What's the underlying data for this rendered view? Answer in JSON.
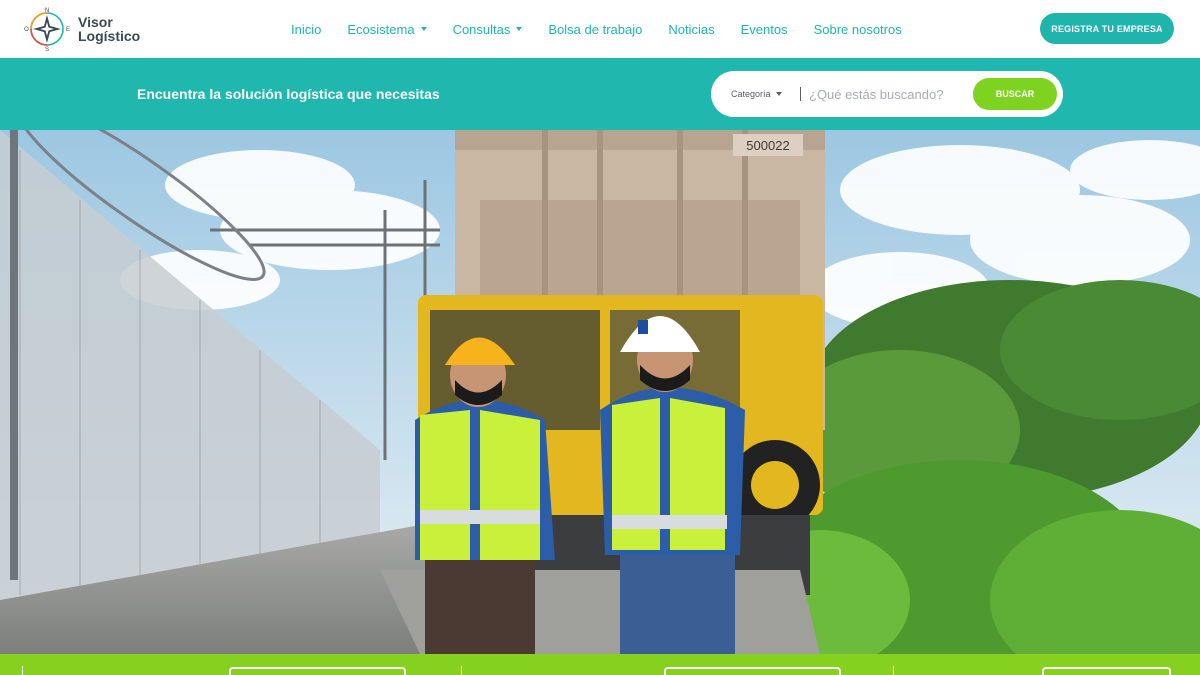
{
  "header": {
    "logo_line1": "Visor",
    "logo_line2": "Logístico",
    "compass_letters": {
      "n": "N",
      "e": "E",
      "s": "S",
      "o": "O"
    },
    "nav": [
      {
        "label": "Inicio",
        "dropdown": false
      },
      {
        "label": "Ecosistema",
        "dropdown": true
      },
      {
        "label": "Consultas",
        "dropdown": true
      },
      {
        "label": "Bolsa de trabajo",
        "dropdown": false
      },
      {
        "label": "Noticias",
        "dropdown": false
      },
      {
        "label": "Eventos",
        "dropdown": false
      },
      {
        "label": "Sobre nosotros",
        "dropdown": false
      }
    ],
    "register_label": "REGISTRA TU EMPRESA"
  },
  "search": {
    "tagline": "Encuentra la solución logística que necesitas",
    "category_label": "Categoría",
    "placeholder": "¿Qué estás buscando?",
    "button_label": "BUSCAR"
  },
  "hero": {
    "railcar_number": "500022"
  },
  "colors": {
    "teal": "#20b8ae",
    "green": "#86d11f",
    "nav_text": "#1fb5ad",
    "logo_text": "#3a4a55"
  },
  "icons": [
    "compass-logo-icon",
    "chevron-down-icon"
  ]
}
